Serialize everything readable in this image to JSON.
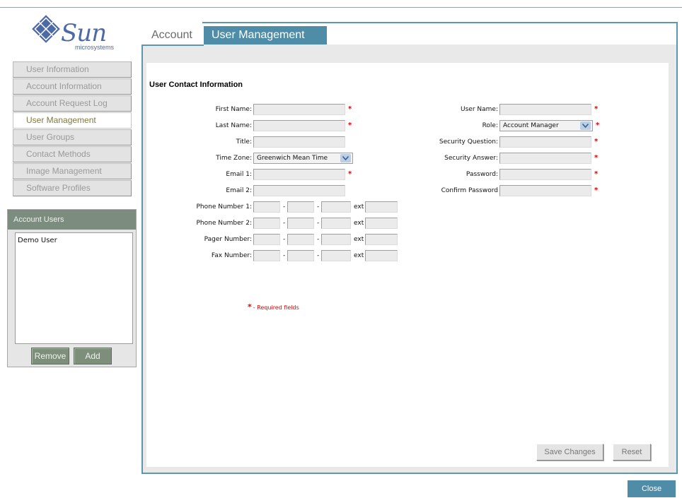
{
  "brand": {
    "name": "Sun",
    "subtitle": "microsystems"
  },
  "nav": {
    "items": [
      {
        "label": "User Information",
        "active": false
      },
      {
        "label": "Account Information",
        "active": false
      },
      {
        "label": "Account Request Log",
        "active": false
      },
      {
        "label": "User Management",
        "active": true
      },
      {
        "label": "User Groups",
        "active": false
      },
      {
        "label": "Contact Methods",
        "active": false
      },
      {
        "label": "Image Management",
        "active": false
      },
      {
        "label": "Software Profiles",
        "active": false
      }
    ]
  },
  "account_users": {
    "title": "Account Users",
    "users": [
      "Demo User"
    ],
    "remove_label": "Remove",
    "add_label": "Add"
  },
  "tabs": {
    "account": "Account",
    "user_management": "User Management"
  },
  "form": {
    "section_title": "User Contact Information",
    "left": {
      "first_name": "First Name:",
      "last_name": "Last Name:",
      "title": "Title:",
      "time_zone": "Time Zone:",
      "time_zone_value": "Greenwich Mean Time",
      "email1": "Email 1:",
      "email2": "Email 2:",
      "phone1": "Phone Number 1:",
      "phone2": "Phone Number 2:",
      "pager": "Pager Number:",
      "fax": "Fax Number:",
      "ext": "ext",
      "dash": "-"
    },
    "right": {
      "user_name": "User Name:",
      "role": "Role:",
      "role_value": "Account Manager",
      "security_question": "Security Question:",
      "security_answer": "Security Answer:",
      "password": "Password:",
      "confirm_password": "Confirm Password"
    },
    "required_marker": "*",
    "required_note": "- Required fields"
  },
  "actions": {
    "save": "Save Changes",
    "reset": "Reset",
    "close": "Close"
  },
  "colors": {
    "accent": "#4e8ca8",
    "required": "#e00000",
    "panel_header": "#7c8c7e"
  }
}
